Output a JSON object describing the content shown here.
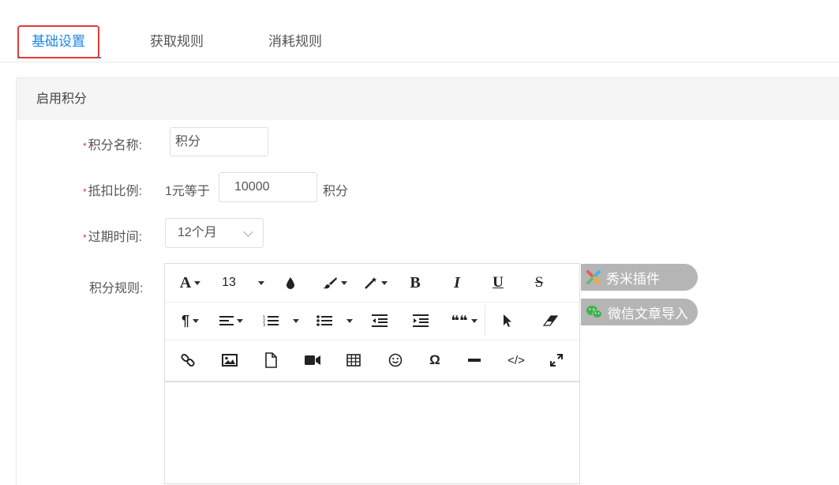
{
  "tabs": [
    {
      "label": "基础设置",
      "active": true
    },
    {
      "label": "获取规则",
      "active": false
    },
    {
      "label": "消耗规则",
      "active": false
    }
  ],
  "panel": {
    "title": "启用积分"
  },
  "form": {
    "name": {
      "required_mark": "*",
      "label": "积分名称:",
      "value": "积分"
    },
    "ratio": {
      "required_mark": "*",
      "label": "抵扣比例:",
      "prefix": "1元等于",
      "value": "10000",
      "suffix": "积分"
    },
    "expire": {
      "required_mark": "*",
      "label": "过期时间:",
      "value": "12个月"
    },
    "rules": {
      "label": "积分规则:"
    }
  },
  "editor": {
    "font_size": "13",
    "icons": [
      "font-color-icon",
      "font-size-icon",
      "ink-drop-icon",
      "brush-icon",
      "magic-wand-icon",
      "bold-icon",
      "italic-icon",
      "underline-icon",
      "strikethrough-icon",
      "paragraph-icon",
      "align-icon",
      "ordered-list-icon",
      "unordered-list-icon",
      "outdent-icon",
      "indent-icon",
      "quote-icon",
      "cursor-icon",
      "eraser-icon",
      "link-icon",
      "image-icon",
      "file-icon",
      "video-icon",
      "table-icon",
      "emoji-icon",
      "omega-icon",
      "horizontal-rule-icon",
      "code-icon",
      "fullscreen-icon"
    ],
    "bold_glyph": "B",
    "italic_glyph": "I",
    "underline_glyph": "U",
    "strike_glyph": "S",
    "font_glyph": "A",
    "para_glyph": "¶",
    "omega_glyph": "Ω",
    "quote_glyph": "❝❝",
    "code_glyph": "</>"
  },
  "plugins": [
    {
      "label": "秀米插件"
    },
    {
      "label": "微信文章导入"
    }
  ],
  "colors": {
    "accent": "#1e88e5",
    "highlight": "#e53935",
    "plugin_bg": "#b5b5b5"
  }
}
